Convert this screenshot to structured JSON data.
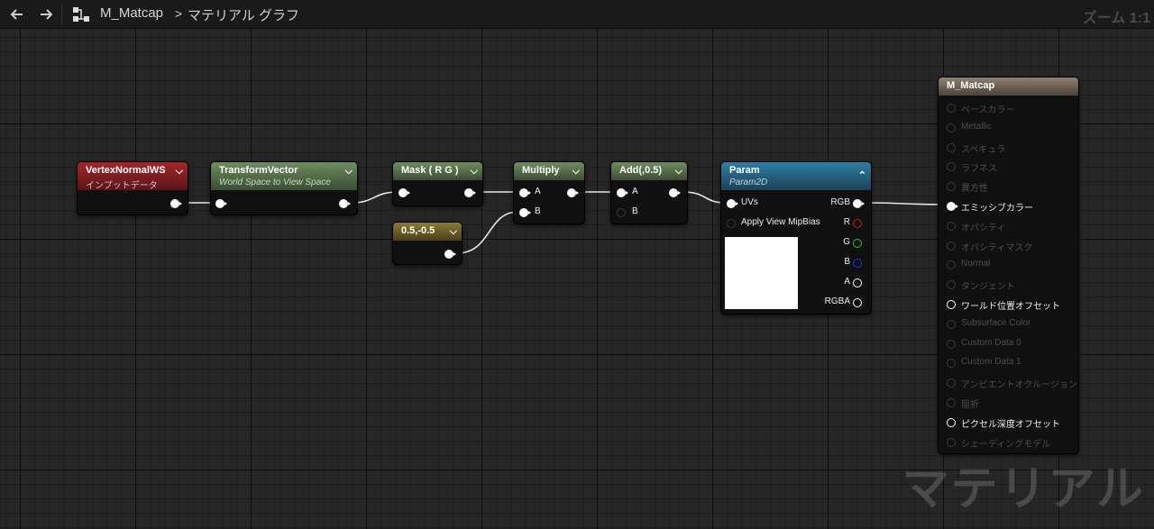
{
  "toolbar": {
    "back_icon": "arrow-left-icon",
    "forward_icon": "arrow-right-icon",
    "graph_icon": "node-graph-icon",
    "asset_name": "M_Matcap",
    "separator": ">",
    "graph_name": "マテリアル グラフ",
    "zoom_label": "ズーム 1:1"
  },
  "watermark": "マテリアル",
  "nodes": {
    "vertex_normal": {
      "title": "VertexNormalWS",
      "subtitle": "インプットデータ"
    },
    "transform_vector": {
      "title": "TransformVector",
      "subtitle": "World Space to View Space"
    },
    "mask": {
      "title": "Mask ( R G )"
    },
    "constant": {
      "title": "0.5,-0.5"
    },
    "multiply": {
      "title": "Multiply",
      "pin_a": "A",
      "pin_b": "B"
    },
    "add": {
      "title": "Add(,0.5)",
      "pin_a": "A",
      "pin_b": "B"
    },
    "param": {
      "title": "Param",
      "subtitle": "Param2D",
      "inputs": [
        "UVs",
        "Apply View MipBias"
      ],
      "outputs": [
        "RGB",
        "R",
        "G",
        "B",
        "A",
        "RGBA"
      ]
    },
    "result": {
      "title": "M_Matcap",
      "inputs": [
        {
          "label": "ベースカラー",
          "active": false
        },
        {
          "label": "Metallic",
          "active": false
        },
        {
          "label": "スペキュラ",
          "active": false
        },
        {
          "label": "ラフネス",
          "active": false
        },
        {
          "label": "異方性",
          "active": false
        },
        {
          "label": "エミッシブカラー",
          "active": true,
          "connected": true
        },
        {
          "label": "オパシティ",
          "active": false
        },
        {
          "label": "オパシティマスク",
          "active": false
        },
        {
          "label": "Normal",
          "active": false
        },
        {
          "label": "タンジェント",
          "active": false
        },
        {
          "label": "ワールド位置オフセット",
          "active": true,
          "connected": false
        },
        {
          "label": "Subsurface Color",
          "active": false
        },
        {
          "label": "Custom Data 0",
          "active": false
        },
        {
          "label": "Custom Data 1",
          "active": false
        },
        {
          "label": "アンビエントオクルージョン",
          "active": false
        },
        {
          "label": "屈折",
          "active": false
        },
        {
          "label": "ピクセル深度オフセット",
          "active": true,
          "connected": false
        },
        {
          "label": "シェーディングモデル",
          "active": false
        }
      ]
    }
  }
}
